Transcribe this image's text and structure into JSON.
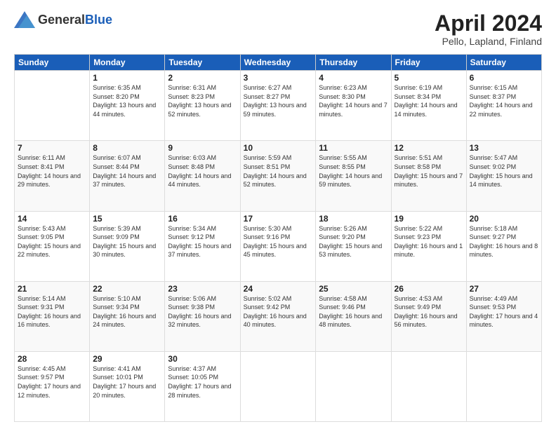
{
  "header": {
    "logo_general": "General",
    "logo_blue": "Blue",
    "month": "April 2024",
    "location": "Pello, Lapland, Finland"
  },
  "days_of_week": [
    "Sunday",
    "Monday",
    "Tuesday",
    "Wednesday",
    "Thursday",
    "Friday",
    "Saturday"
  ],
  "weeks": [
    [
      {
        "day": "",
        "sunrise": "",
        "sunset": "",
        "daylight": ""
      },
      {
        "day": "1",
        "sunrise": "Sunrise: 6:35 AM",
        "sunset": "Sunset: 8:20 PM",
        "daylight": "Daylight: 13 hours and 44 minutes."
      },
      {
        "day": "2",
        "sunrise": "Sunrise: 6:31 AM",
        "sunset": "Sunset: 8:23 PM",
        "daylight": "Daylight: 13 hours and 52 minutes."
      },
      {
        "day": "3",
        "sunrise": "Sunrise: 6:27 AM",
        "sunset": "Sunset: 8:27 PM",
        "daylight": "Daylight: 13 hours and 59 minutes."
      },
      {
        "day": "4",
        "sunrise": "Sunrise: 6:23 AM",
        "sunset": "Sunset: 8:30 PM",
        "daylight": "Daylight: 14 hours and 7 minutes."
      },
      {
        "day": "5",
        "sunrise": "Sunrise: 6:19 AM",
        "sunset": "Sunset: 8:34 PM",
        "daylight": "Daylight: 14 hours and 14 minutes."
      },
      {
        "day": "6",
        "sunrise": "Sunrise: 6:15 AM",
        "sunset": "Sunset: 8:37 PM",
        "daylight": "Daylight: 14 hours and 22 minutes."
      }
    ],
    [
      {
        "day": "7",
        "sunrise": "Sunrise: 6:11 AM",
        "sunset": "Sunset: 8:41 PM",
        "daylight": "Daylight: 14 hours and 29 minutes."
      },
      {
        "day": "8",
        "sunrise": "Sunrise: 6:07 AM",
        "sunset": "Sunset: 8:44 PM",
        "daylight": "Daylight: 14 hours and 37 minutes."
      },
      {
        "day": "9",
        "sunrise": "Sunrise: 6:03 AM",
        "sunset": "Sunset: 8:48 PM",
        "daylight": "Daylight: 14 hours and 44 minutes."
      },
      {
        "day": "10",
        "sunrise": "Sunrise: 5:59 AM",
        "sunset": "Sunset: 8:51 PM",
        "daylight": "Daylight: 14 hours and 52 minutes."
      },
      {
        "day": "11",
        "sunrise": "Sunrise: 5:55 AM",
        "sunset": "Sunset: 8:55 PM",
        "daylight": "Daylight: 14 hours and 59 minutes."
      },
      {
        "day": "12",
        "sunrise": "Sunrise: 5:51 AM",
        "sunset": "Sunset: 8:58 PM",
        "daylight": "Daylight: 15 hours and 7 minutes."
      },
      {
        "day": "13",
        "sunrise": "Sunrise: 5:47 AM",
        "sunset": "Sunset: 9:02 PM",
        "daylight": "Daylight: 15 hours and 14 minutes."
      }
    ],
    [
      {
        "day": "14",
        "sunrise": "Sunrise: 5:43 AM",
        "sunset": "Sunset: 9:05 PM",
        "daylight": "Daylight: 15 hours and 22 minutes."
      },
      {
        "day": "15",
        "sunrise": "Sunrise: 5:39 AM",
        "sunset": "Sunset: 9:09 PM",
        "daylight": "Daylight: 15 hours and 30 minutes."
      },
      {
        "day": "16",
        "sunrise": "Sunrise: 5:34 AM",
        "sunset": "Sunset: 9:12 PM",
        "daylight": "Daylight: 15 hours and 37 minutes."
      },
      {
        "day": "17",
        "sunrise": "Sunrise: 5:30 AM",
        "sunset": "Sunset: 9:16 PM",
        "daylight": "Daylight: 15 hours and 45 minutes."
      },
      {
        "day": "18",
        "sunrise": "Sunrise: 5:26 AM",
        "sunset": "Sunset: 9:20 PM",
        "daylight": "Daylight: 15 hours and 53 minutes."
      },
      {
        "day": "19",
        "sunrise": "Sunrise: 5:22 AM",
        "sunset": "Sunset: 9:23 PM",
        "daylight": "Daylight: 16 hours and 1 minute."
      },
      {
        "day": "20",
        "sunrise": "Sunrise: 5:18 AM",
        "sunset": "Sunset: 9:27 PM",
        "daylight": "Daylight: 16 hours and 8 minutes."
      }
    ],
    [
      {
        "day": "21",
        "sunrise": "Sunrise: 5:14 AM",
        "sunset": "Sunset: 9:31 PM",
        "daylight": "Daylight: 16 hours and 16 minutes."
      },
      {
        "day": "22",
        "sunrise": "Sunrise: 5:10 AM",
        "sunset": "Sunset: 9:34 PM",
        "daylight": "Daylight: 16 hours and 24 minutes."
      },
      {
        "day": "23",
        "sunrise": "Sunrise: 5:06 AM",
        "sunset": "Sunset: 9:38 PM",
        "daylight": "Daylight: 16 hours and 32 minutes."
      },
      {
        "day": "24",
        "sunrise": "Sunrise: 5:02 AM",
        "sunset": "Sunset: 9:42 PM",
        "daylight": "Daylight: 16 hours and 40 minutes."
      },
      {
        "day": "25",
        "sunrise": "Sunrise: 4:58 AM",
        "sunset": "Sunset: 9:46 PM",
        "daylight": "Daylight: 16 hours and 48 minutes."
      },
      {
        "day": "26",
        "sunrise": "Sunrise: 4:53 AM",
        "sunset": "Sunset: 9:49 PM",
        "daylight": "Daylight: 16 hours and 56 minutes."
      },
      {
        "day": "27",
        "sunrise": "Sunrise: 4:49 AM",
        "sunset": "Sunset: 9:53 PM",
        "daylight": "Daylight: 17 hours and 4 minutes."
      }
    ],
    [
      {
        "day": "28",
        "sunrise": "Sunrise: 4:45 AM",
        "sunset": "Sunset: 9:57 PM",
        "daylight": "Daylight: 17 hours and 12 minutes."
      },
      {
        "day": "29",
        "sunrise": "Sunrise: 4:41 AM",
        "sunset": "Sunset: 10:01 PM",
        "daylight": "Daylight: 17 hours and 20 minutes."
      },
      {
        "day": "30",
        "sunrise": "Sunrise: 4:37 AM",
        "sunset": "Sunset: 10:05 PM",
        "daylight": "Daylight: 17 hours and 28 minutes."
      },
      {
        "day": "",
        "sunrise": "",
        "sunset": "",
        "daylight": ""
      },
      {
        "day": "",
        "sunrise": "",
        "sunset": "",
        "daylight": ""
      },
      {
        "day": "",
        "sunrise": "",
        "sunset": "",
        "daylight": ""
      },
      {
        "day": "",
        "sunrise": "",
        "sunset": "",
        "daylight": ""
      }
    ]
  ]
}
